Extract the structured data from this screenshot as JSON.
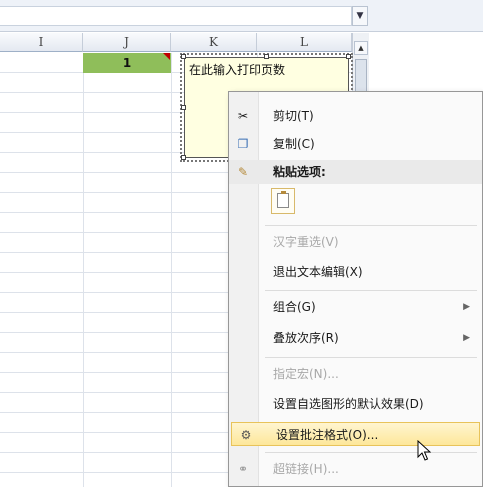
{
  "columns": {
    "I": "I",
    "J": "J",
    "K": "K",
    "L": "L"
  },
  "cell_J1": "1",
  "comment": {
    "text": "在此输入打印页数"
  },
  "menu": {
    "cut": "剪切(T)",
    "copy": "复制(C)",
    "paste_options": "粘贴选项:",
    "hanzi_reselect": "汉字重选(V)",
    "exit_text_edit": "退出文本编辑(X)",
    "group": "组合(G)",
    "order": "叠放次序(R)",
    "assign_macro": "指定宏(N)...",
    "set_autoshape_defaults": "设置自选图形的默认效果(D)",
    "format_comment": "设置批注格式(O)...",
    "hyperlink": "超链接(H)..."
  },
  "icons": {
    "cut": "scissors-icon",
    "copy": "copy-icon",
    "paste": "paste-icon",
    "format": "format-comment-icon",
    "hyperlink": "hyperlink-icon"
  },
  "colors": {
    "selected_cell": "#8fbe5a",
    "comment_bg": "#ffffe1",
    "menu_hover": "#fde79a"
  }
}
